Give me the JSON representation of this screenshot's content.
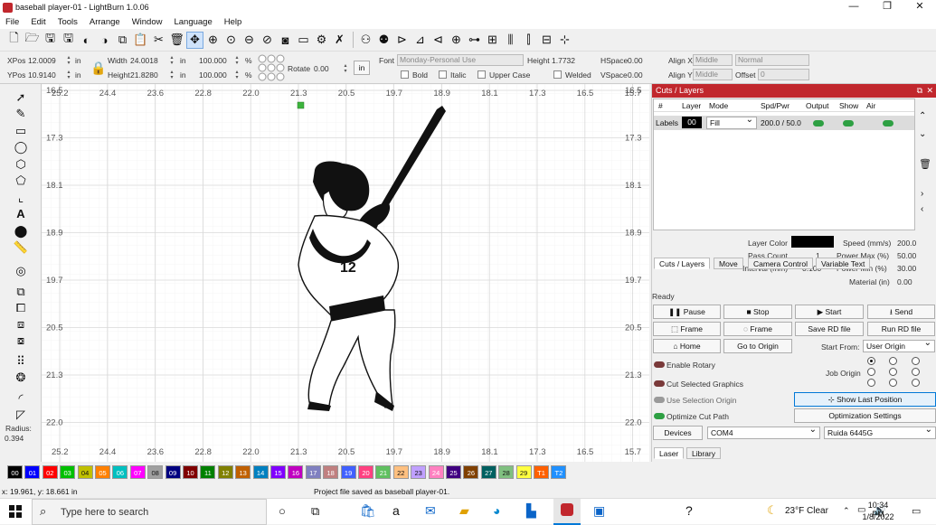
{
  "window": {
    "title": "baseball player-01 - LightBurn 1.0.06",
    "minimize": "—",
    "maximize": "❐",
    "close": "✕"
  },
  "menu": [
    "File",
    "Edit",
    "Tools",
    "Arrange",
    "Window",
    "Language",
    "Help"
  ],
  "toolbar2": {
    "xpos_label": "XPos",
    "xpos_value": "12.0009",
    "ypos_label": "YPos",
    "ypos_value": "10.9140",
    "unit_in": "in",
    "width_label": "Width",
    "width_value": "24.0018",
    "height_label": "Height",
    "height_value": "21.8280",
    "scale_w": "100.000",
    "scale_h": "100.000",
    "pct": "%",
    "rotate_label": "Rotate",
    "rotate_value": "0.00",
    "in_button": "in",
    "font_label": "Font",
    "font_value": "Monday-Personal Use",
    "text_height_label": "Height",
    "text_height_value": "1.7732",
    "hspace_label": "HSpace",
    "hspace_value": "0.00",
    "vspace_label": "VSpace",
    "vspace_value": "0.00",
    "alignx_label": "Align X",
    "alignx_value": "Middle",
    "aligny_label": "Align Y",
    "aligny_value": "Middle",
    "normal_value": "Normal",
    "offset_label": "Offset",
    "offset_value": "0",
    "bold": "Bold",
    "italic": "Italic",
    "upper": "Upper Case",
    "welded": "Welded"
  },
  "ruler": {
    "top": [
      "25.2",
      "24.4",
      "23.6",
      "22.8",
      "22.0",
      "21.3",
      "20.5",
      "19.7",
      "18.9",
      "18.1",
      "17.3",
      "16.5",
      "15.7"
    ],
    "left": [
      "16.5",
      "17.3",
      "18.1",
      "18.9",
      "19.7",
      "20.5",
      "21.3",
      "22.0"
    ]
  },
  "figure": {
    "jersey_number": "12"
  },
  "left_tools": {
    "radius_label": "Radius:",
    "radius_value": "0.394"
  },
  "palette": [
    {
      "label": "00",
      "color": "#000000"
    },
    {
      "label": "01",
      "color": "#0000ff"
    },
    {
      "label": "02",
      "color": "#ff0000"
    },
    {
      "label": "03",
      "color": "#00c000"
    },
    {
      "label": "04",
      "color": "#c0c000"
    },
    {
      "label": "05",
      "color": "#ff8000"
    },
    {
      "label": "06",
      "color": "#00c0c0"
    },
    {
      "label": "07",
      "color": "#ff00ff"
    },
    {
      "label": "08",
      "color": "#a0a0a0"
    },
    {
      "label": "09",
      "color": "#000080"
    },
    {
      "label": "10",
      "color": "#800000"
    },
    {
      "label": "11",
      "color": "#008000"
    },
    {
      "label": "12",
      "color": "#808000"
    },
    {
      "label": "13",
      "color": "#c06000"
    },
    {
      "label": "14",
      "color": "#0080c0"
    },
    {
      "label": "15",
      "color": "#8000ff"
    },
    {
      "label": "16",
      "color": "#c000c0"
    },
    {
      "label": "17",
      "color": "#8080c0"
    },
    {
      "label": "18",
      "color": "#c08080"
    },
    {
      "label": "19",
      "color": "#4060ff"
    },
    {
      "label": "20",
      "color": "#ff4080"
    },
    {
      "label": "21",
      "color": "#60c060"
    },
    {
      "label": "22",
      "color": "#ffc080"
    },
    {
      "label": "23",
      "color": "#c0a0ff"
    },
    {
      "label": "24",
      "color": "#ff80c0"
    },
    {
      "label": "25",
      "color": "#400080"
    },
    {
      "label": "26",
      "color": "#804000"
    },
    {
      "label": "27",
      "color": "#006060"
    },
    {
      "label": "28",
      "color": "#80c080"
    },
    {
      "label": "29",
      "color": "#ffff40"
    },
    {
      "label": "T1",
      "color": "#ff6000"
    },
    {
      "label": "T2",
      "color": "#2090ff"
    }
  ],
  "status": {
    "coords": "x: 19.961, y: 18.661 in",
    "message": "Project file saved as baseball player-01."
  },
  "cuts": {
    "panel_title": "Cuts / Layers",
    "headers": [
      "#",
      "Layer",
      "Mode",
      "Spd/Pwr",
      "Output",
      "Show",
      "Air"
    ],
    "row": {
      "name": "Labels",
      "layer": "00",
      "mode": "Fill",
      "spdpwr": "200.0 / 50.0"
    },
    "layer_color_label": "Layer Color",
    "layer_color": "#000000",
    "pass_count_label": "Pass Count",
    "pass_count_value": "1",
    "interval_label": "Interval (mm)",
    "interval_value": "0.100",
    "speed_label": "Speed (mm/s)",
    "speed_value": "200.0",
    "powermax_label": "Power Max (%)",
    "powermax_value": "50.00",
    "powermin_label": "Power Min (%)",
    "powermin_value": "30.00",
    "material_label": "Material (in)",
    "material_value": "0.00"
  },
  "tabs": [
    "Cuts / Layers",
    "Move",
    "Camera Control",
    "Variable Text"
  ],
  "laser": {
    "ready": "Ready",
    "pause": "Pause",
    "stop": "Stop",
    "start": "Start",
    "send": "Send",
    "frame1": "Frame",
    "frame2": "Frame",
    "save_rd": "Save RD file",
    "run_rd": "Run RD file",
    "home": "Home",
    "go_origin": "Go to Origin",
    "start_from_label": "Start From:",
    "start_from_value": "User Origin",
    "enable_rotary": "Enable Rotary",
    "job_origin": "Job Origin",
    "cut_selected": "Cut Selected Graphics",
    "use_selection_origin": "Use Selection Origin",
    "show_last_position": "Show Last Position",
    "optimize_cut_path": "Optimize Cut Path",
    "optimization_settings": "Optimization Settings",
    "devices": "Devices",
    "port": "COM4",
    "controller": "Ruida 6445G"
  },
  "bottom_tabs": [
    "Laser",
    "Library"
  ],
  "taskbar": {
    "search_placeholder": "Type here to search",
    "weather": "23°F  Clear",
    "time": "10:34 PM",
    "date": "1/8/2022"
  }
}
